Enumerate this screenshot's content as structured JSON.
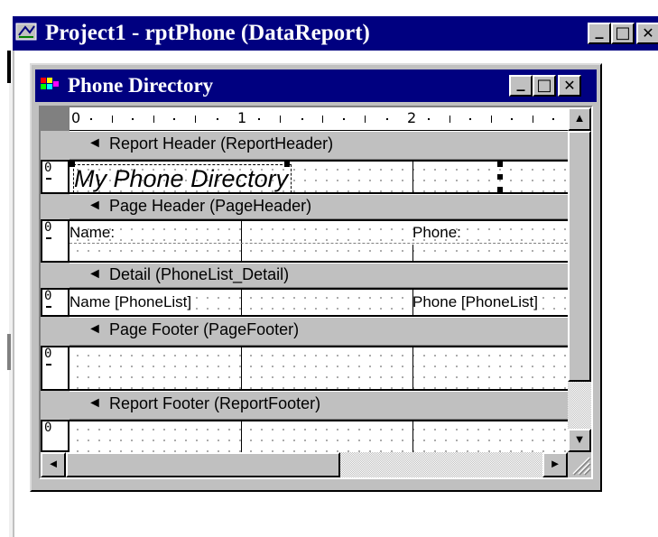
{
  "outer_window": {
    "title": "Project1 - rptPhone (DataReport)",
    "minimize_glyph": "_",
    "maximize_glyph": "□",
    "close_glyph": "✕"
  },
  "report_window": {
    "title": "Phone Directory",
    "minimize_glyph": "_",
    "maximize_glyph": "□",
    "close_glyph": "✕"
  },
  "ruler": {
    "labels": [
      "0",
      "1",
      "2"
    ]
  },
  "bands": [
    {
      "header": "Report Header (ReportHeader)",
      "arrow": "◄",
      "controls": [
        {
          "text": "My Phone Directory"
        }
      ]
    },
    {
      "header": "Page Header (PageHeader)",
      "arrow": "◄",
      "controls": [
        {
          "text": "Name:"
        },
        {
          "text": "Phone:"
        }
      ]
    },
    {
      "header": "Detail (PhoneList_Detail)",
      "arrow": "◄",
      "controls": [
        {
          "text": "Name [PhoneList]"
        },
        {
          "text": "Phone [PhoneList]"
        }
      ]
    },
    {
      "header": "Page Footer (PageFooter)",
      "arrow": "◄",
      "controls": []
    },
    {
      "header": "Report Footer (ReportFooter)",
      "arrow": "◄",
      "controls": []
    }
  ],
  "gutter_label": "0",
  "scroll": {
    "up": "▲",
    "down": "▼",
    "left": "◄",
    "right": "►"
  }
}
